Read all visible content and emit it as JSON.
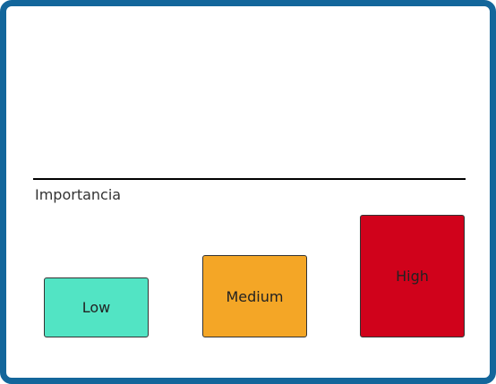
{
  "axis": {
    "label": "Importancia"
  },
  "levels": [
    {
      "label": "Low",
      "color": "#52e4c4"
    },
    {
      "label": "Medium",
      "color": "#f4a626"
    },
    {
      "label": "High",
      "color": "#d0021b"
    }
  ],
  "colors": {
    "frame": "#13669b"
  }
}
